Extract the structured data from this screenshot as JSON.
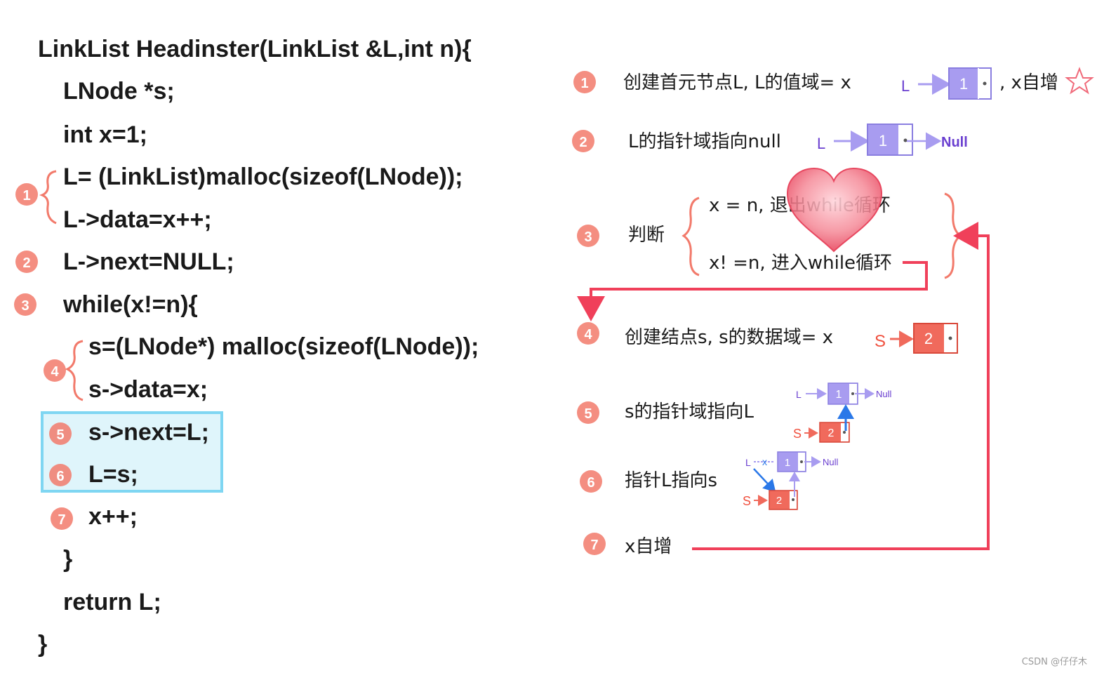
{
  "code": {
    "lines": [
      "LinkList Headinster(LinkList &L,int n){",
      "LNode *s;",
      "int x=1;",
      "L= (LinkList)malloc(sizeof(LNode));",
      "L->data=x++;",
      "L->next=NULL;",
      "while(x!=n){",
      "s=(LNode*) malloc(sizeof(LNode));",
      "s->data=x;",
      "s->next=L;",
      "L=s;",
      "x++;",
      "}",
      "return L;",
      "}"
    ],
    "markers": [
      "1",
      "2",
      "3",
      "4",
      "5",
      "6",
      "7"
    ]
  },
  "steps": {
    "s1": {
      "num": "1",
      "text": "创建首元节点L, L的值域= x",
      "ptr": "L",
      "node": "1",
      "suffix": ", x自增"
    },
    "s2": {
      "num": "2",
      "text": "L的指针域指向null",
      "ptr": "L",
      "node": "1",
      "null": "Null"
    },
    "s3": {
      "num": "3",
      "label": "判断",
      "opt1": "x = n, 退出while循环",
      "opt2": "x! =n, 进入while循环"
    },
    "s4": {
      "num": "4",
      "text": "创建结点s, s的数据域= x",
      "ptr": "S",
      "node": "2"
    },
    "s5": {
      "num": "5",
      "text": "s的指针域指向L",
      "ptrL": "L",
      "ptrS": "S",
      "nodeL": "1",
      "nodeS": "2",
      "null": "Null"
    },
    "s6": {
      "num": "6",
      "text": "指针L指向s",
      "ptrL": "L",
      "ptrS": "S",
      "nodeL": "1",
      "nodeS": "2",
      "null": "Null",
      "cross": "x"
    },
    "s7": {
      "num": "7",
      "text": "x自增"
    }
  },
  "watermark": "CSDN @仔仔木",
  "colors": {
    "marker": "#f27a6b",
    "nodeL": "#a89cf0",
    "nodeLBorder": "#8a7ee0",
    "labelL": "#6a3fd0",
    "nodeS": "#f06a5c",
    "labelS": "#f0503e",
    "arrowRed": "#f0405a",
    "arrowBlue": "#2a78e8",
    "highlight": "#dff5fb",
    "heart": "#f0606e"
  }
}
